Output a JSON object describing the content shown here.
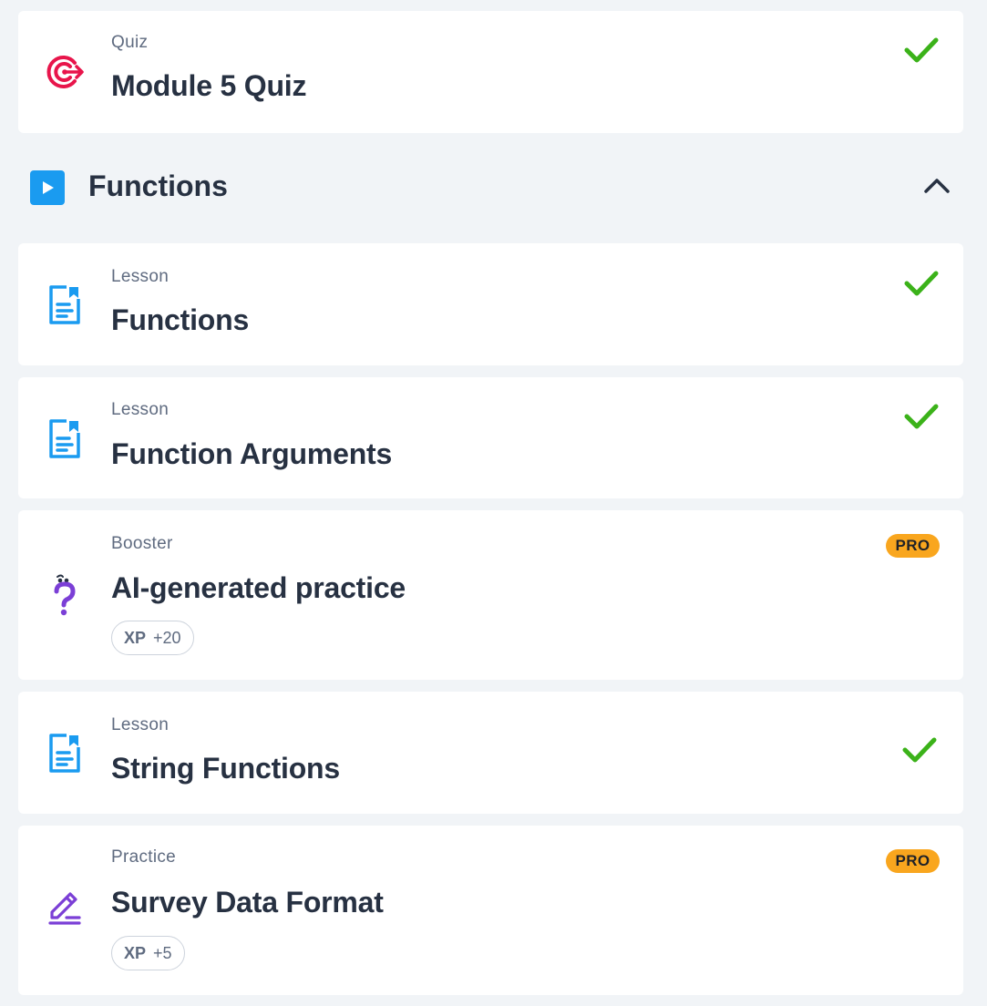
{
  "items_top": {
    "quiz": {
      "type": "Quiz",
      "title": "Module 5 Quiz",
      "completed": true,
      "icon": "target-icon"
    }
  },
  "section": {
    "title": "Functions",
    "icon": "play-icon",
    "collapse_icon": "chevron-up-icon"
  },
  "items": [
    {
      "type": "Lesson",
      "title": "Functions",
      "completed": true,
      "icon": "lesson-document-icon"
    },
    {
      "type": "Lesson",
      "title": "Function Arguments",
      "completed": true,
      "icon": "lesson-document-icon"
    },
    {
      "type": "Booster",
      "title": "AI-generated practice",
      "badge": "PRO",
      "xp_label": "XP",
      "xp_value": "+20",
      "icon": "question-mark-icon"
    },
    {
      "type": "Lesson",
      "title": "String Functions",
      "completed": true,
      "icon": "lesson-document-icon"
    },
    {
      "type": "Practice",
      "title": "Survey Data Format",
      "badge": "PRO",
      "xp_label": "XP",
      "xp_value": "+5",
      "icon": "pencil-icon"
    }
  ],
  "colors": {
    "accent_blue": "#1a9bf0",
    "check_green": "#3bb219",
    "pro_orange": "#f9a61e",
    "quiz_red": "#e8154b",
    "purple": "#7b3fd6"
  }
}
